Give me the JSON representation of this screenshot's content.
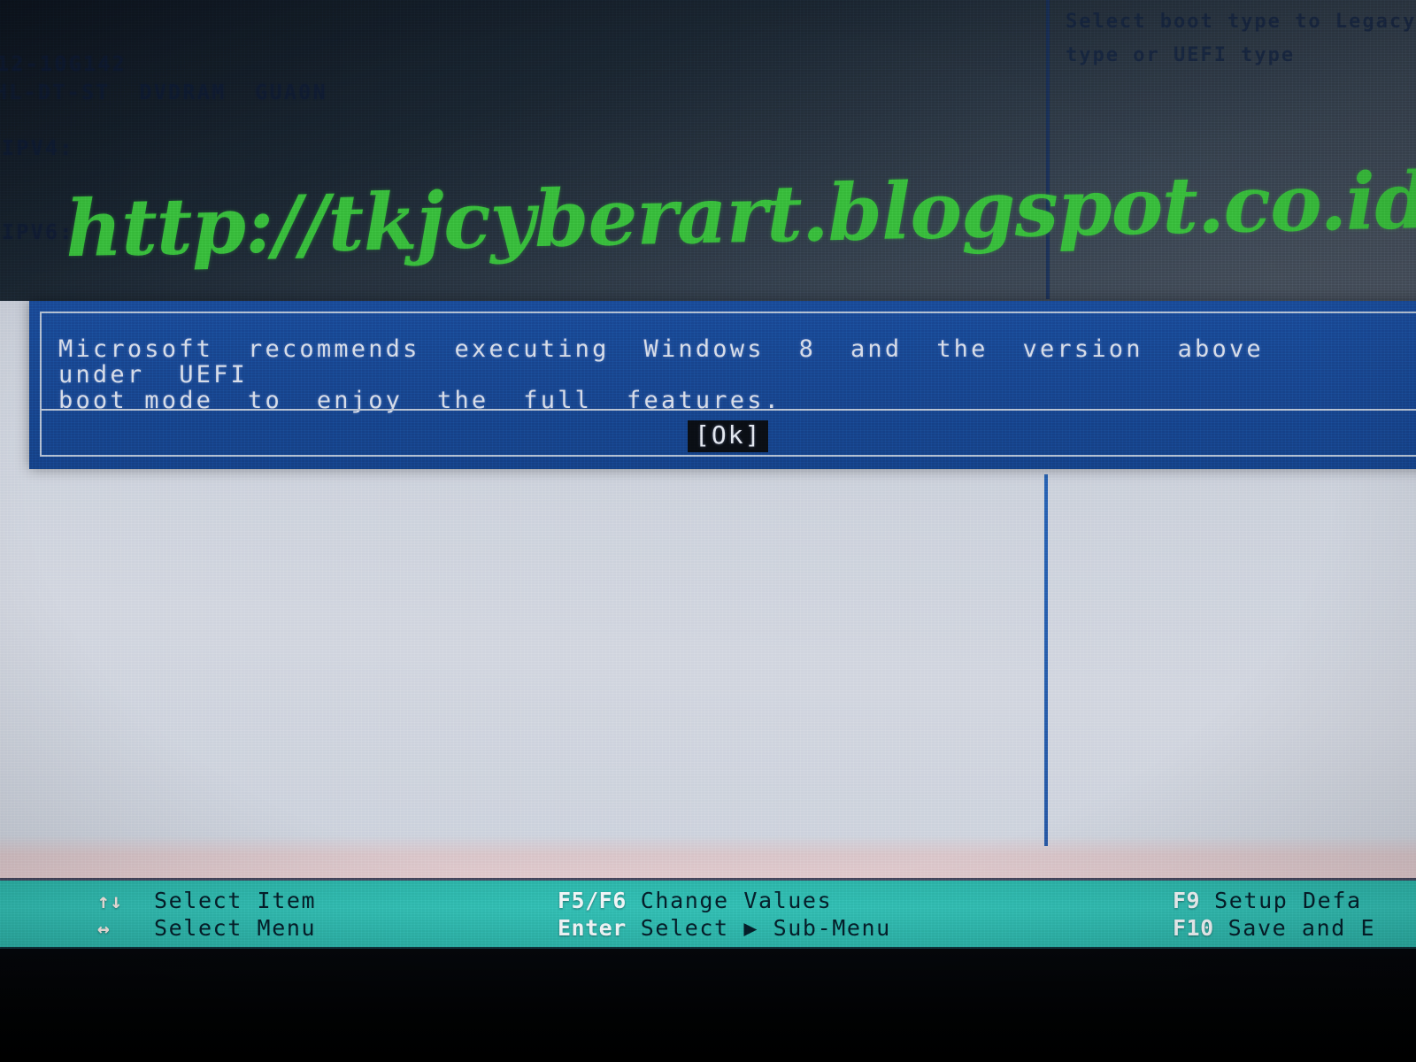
{
  "screen": {
    "upper_bg": "#1b2733",
    "lower_bg": "#d4d8e1",
    "dialog_bg": "#1a4b97",
    "helpbar_bg": "#33beb4",
    "watermark_color": "#3bbf3f"
  },
  "boot_list": {
    "device_id": "12-10G142",
    "optical_drive": "HL-DT-ST  DVDRAM  GUA0N",
    "ipv4_label": "IPV4:",
    "ipv6_label": "IPV6:"
  },
  "help_pane": {
    "lines": [
      "Select boot type to Legacy",
      "type or UEFI type"
    ]
  },
  "dialog": {
    "message": "Microsoft  recommends  executing  Windows  8  and  the  version  above  under  UEFI\nboot mode  to  enjoy  the  full  features.",
    "ok_label": "[Ok]"
  },
  "watermark": {
    "text": "http://tkjcyberart.blogspot.co.id/"
  },
  "help_bar": {
    "left": [
      {
        "key": "↑↓",
        "label": "Select Item"
      },
      {
        "key": "↔",
        "label": "Select Menu"
      }
    ],
    "mid": [
      {
        "key": "F5/F6",
        "label": "Change Values"
      },
      {
        "key": "Enter",
        "label": "Select ▶ Sub-Menu"
      }
    ],
    "right": [
      {
        "key": "F9",
        "label": "Setup Defa"
      },
      {
        "key": "F10",
        "label": "Save and E"
      }
    ]
  }
}
